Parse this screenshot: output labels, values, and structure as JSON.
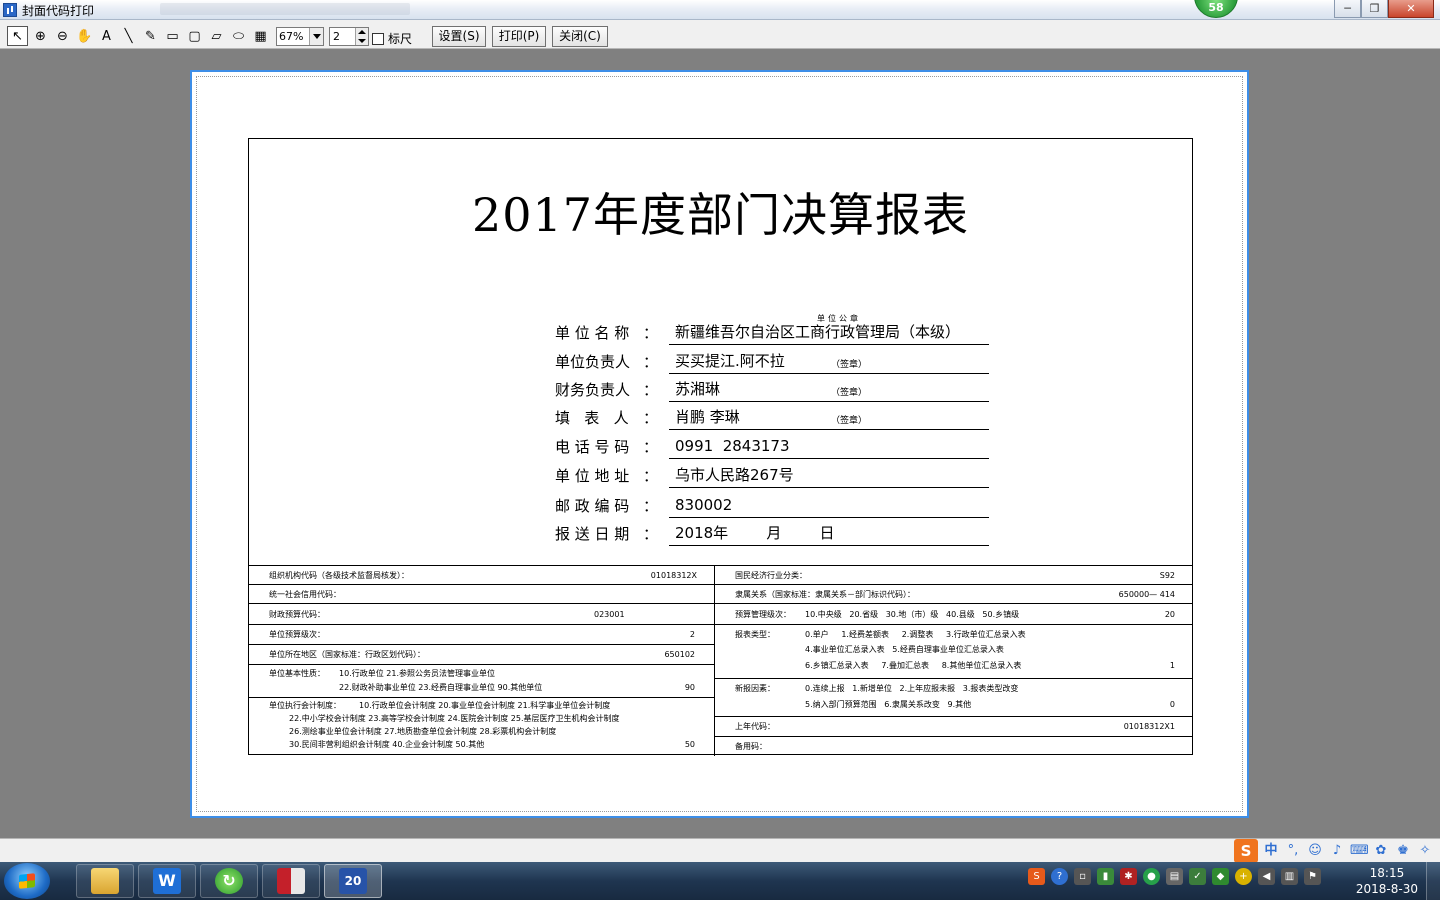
{
  "window": {
    "title": "封面代码打印",
    "badge": "58",
    "minimize": "─",
    "restore": "❐",
    "close": "✕"
  },
  "toolbar": {
    "tools": [
      {
        "name": "pointer-tool",
        "glyph": "↖"
      },
      {
        "name": "zoom-in-tool",
        "glyph": "⊕"
      },
      {
        "name": "zoom-out-tool",
        "glyph": "⊖"
      },
      {
        "name": "hand-tool",
        "glyph": "✋"
      },
      {
        "name": "text-tool",
        "glyph": "A"
      },
      {
        "name": "line-tool",
        "glyph": "╲"
      },
      {
        "name": "pencil-tool",
        "glyph": "✎"
      },
      {
        "name": "rectangle-tool",
        "glyph": "▭"
      },
      {
        "name": "rounded-rect-tool",
        "glyph": "▢"
      },
      {
        "name": "parallelogram-tool",
        "glyph": "▱"
      },
      {
        "name": "ellipse-tool",
        "glyph": "⬭"
      },
      {
        "name": "image-tool",
        "glyph": "▦"
      }
    ],
    "zoom": "67%",
    "page": "2",
    "ruler_label": "标尺",
    "settings_label": "设置",
    "settings_key": "(S)",
    "print_label": "打印",
    "print_key": "(P)",
    "close_label": "关闭",
    "close_key": "(C)"
  },
  "document": {
    "title": "2017年度部门决算报表",
    "seal_text": "单位公章",
    "fields": [
      {
        "label": "单 位 名 称",
        "value": "新疆维吾尔自治区工商行政管理局（本级）",
        "sign": ""
      },
      {
        "label": "单位负责人",
        "value": "买买提江.阿不拉",
        "sign": "（签章）"
      },
      {
        "label": "财务负责人",
        "value": "苏湘琳",
        "sign": "（签章）"
      },
      {
        "label": "填   表   人",
        "value": "肖鹏 李琳",
        "sign": "（签章）"
      },
      {
        "label": "电 话 号 码",
        "value": "0991  2843173",
        "sign": ""
      },
      {
        "label": "单 位 地 址",
        "value": "乌市人民路267号",
        "sign": ""
      },
      {
        "label": "邮 政 编 码",
        "value": "830002",
        "sign": ""
      },
      {
        "label": "报 送 日 期",
        "value": "2018年        月        日",
        "sign": ""
      }
    ],
    "colon": "："
  },
  "info_left": {
    "org_code_label": "组织机构代码（各级技术监督局核发）：",
    "org_code_value": "01018312X",
    "credit_code_label": "统一社会信用代码：",
    "credit_code_value": "",
    "fiscal_code_label": "财政预算代码：",
    "fiscal_code_value": "023001",
    "budget_level_label": "单位预算级次：",
    "budget_level_value": "2",
    "region_label": "单位所在地区（国家标准：行政区划代码）：",
    "region_value": "650102",
    "nature_label": "单位基本性质：",
    "nature_line1": "10.行政单位 21.参照公务员法管理事业单位",
    "nature_line2": "22.财政补助事业单位 23.经费自理事业单位 90.其他单位",
    "nature_value": "90",
    "acct_label": "单位执行会计制度：",
    "acct_line1": "10.行政单位会计制度 20.事业单位会计制度 21.科学事业单位会计制度",
    "acct_line2": "22.中小学校会计制度 23.高等学校会计制度 24.医院会计制度 25.基层医疗卫生机构会计制度",
    "acct_line3": "26.测绘事业单位会计制度 27.地质勘查单位会计制度 28.彩票机构会计制度",
    "acct_line4": "30.民间非营利组织会计制度 40.企业会计制度 50.其他",
    "acct_value": "50"
  },
  "info_right": {
    "industry_label": "国民经济行业分类：",
    "industry_value": "S92",
    "affiliation_label": "隶属关系（国家标准：隶属关系－部门标识代码）：",
    "affiliation_value": "650000— 414",
    "budget_mgmt_label": "预算管理级次：",
    "budget_mgmt_options": "10.中央级   20.省级   30.地（市）级   40.县级   50.乡镇级",
    "budget_mgmt_value": "20",
    "report_type_label": "报表类型：",
    "report_type_line1": "0.单户     1.经费差额表     2.调整表     3.行政单位汇总录入表",
    "report_type_line2": "4.事业单位汇总录入表   5.经费自理事业单位汇总录入表",
    "report_type_line3": "6.乡镇汇总录入表     7.叠加汇总表     8.其他单位汇总录入表",
    "report_type_value": "1",
    "new_reason_label": "新报因素：",
    "new_reason_line1": "0.连续上报   1.新增单位   2.上年应报未报   3.报表类型改变",
    "new_reason_line2": "5.纳入部门预算范围   6.隶属关系改变   9.其他",
    "new_reason_value": "0",
    "last_year_code_label": "上年代码：",
    "last_year_code_value": "01018312X1",
    "backup_code_label": "备用码：",
    "backup_code_value": ""
  },
  "taskbar": {
    "clock_time": "18:15",
    "clock_date": "2018-8-30",
    "ime_logo": "S",
    "ime_lang": "中",
    "ime_punct": "°,"
  }
}
